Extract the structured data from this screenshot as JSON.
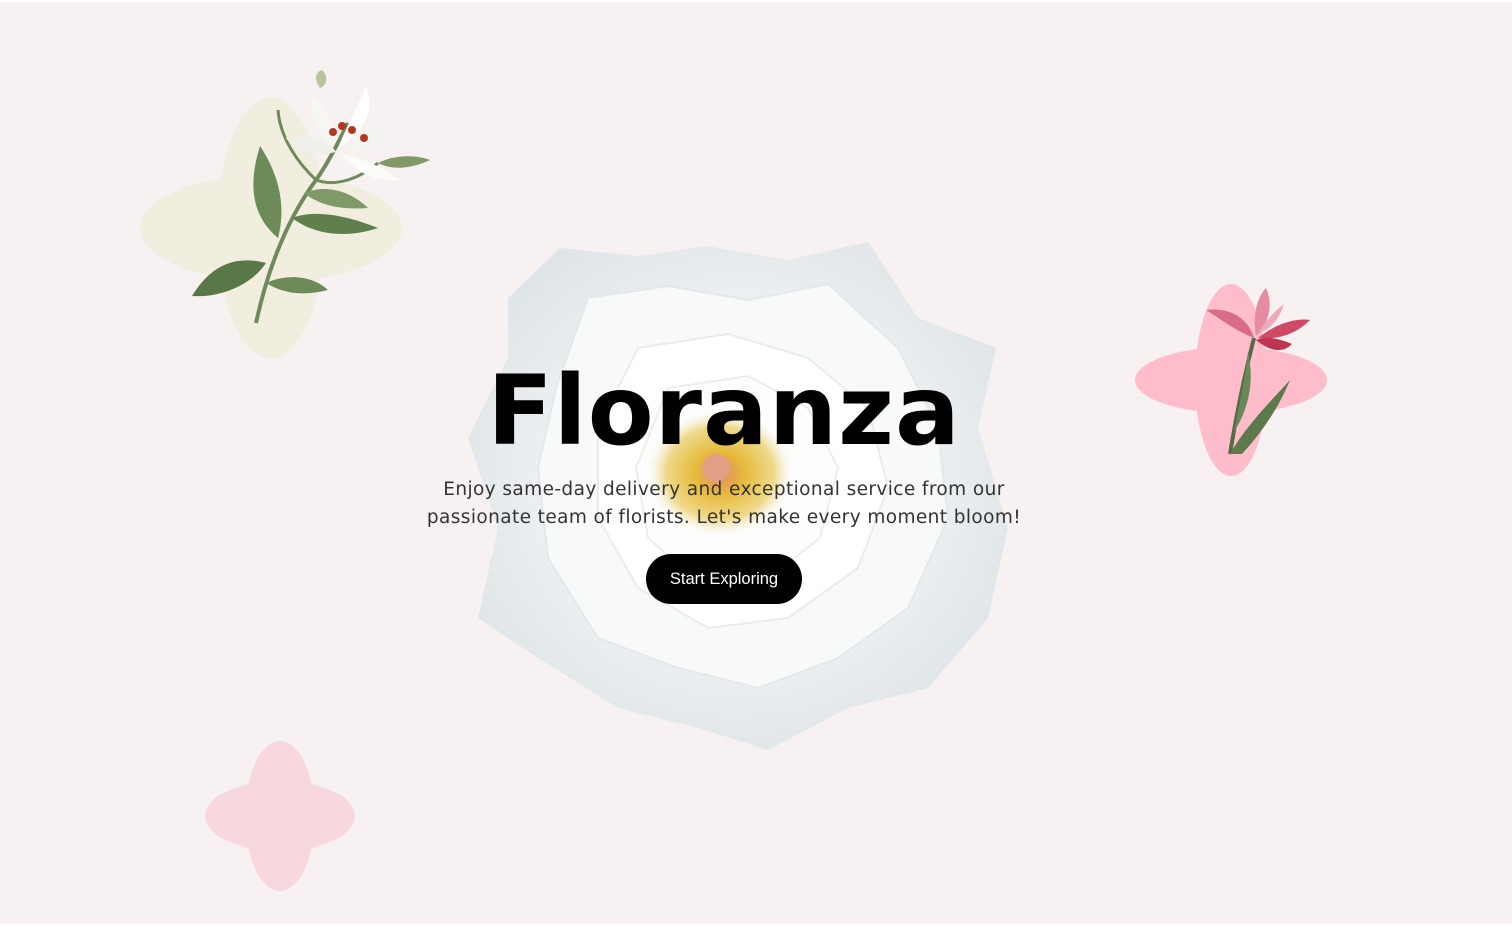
{
  "brand": {
    "title": "Floranza"
  },
  "hero": {
    "subtitle": "Enjoy same-day delivery and exceptional service from our passionate team of florists. Let's make every moment bloom!",
    "cta_label": "Start Exploring"
  },
  "colors": {
    "page_background": "#f7f1f2",
    "cream_shape": "#f1eedf",
    "pink_shape": "#ffbdcb",
    "soft_pink_shape": "#f6d8de",
    "button_background": "#000000",
    "button_text": "#ffffff"
  },
  "decorations": {
    "center_image": "white-rose-image",
    "top_left_image": "white-lily-image",
    "right_image": "pink-lily-image",
    "bottom_left_shape": "pink-quatrefoil"
  }
}
